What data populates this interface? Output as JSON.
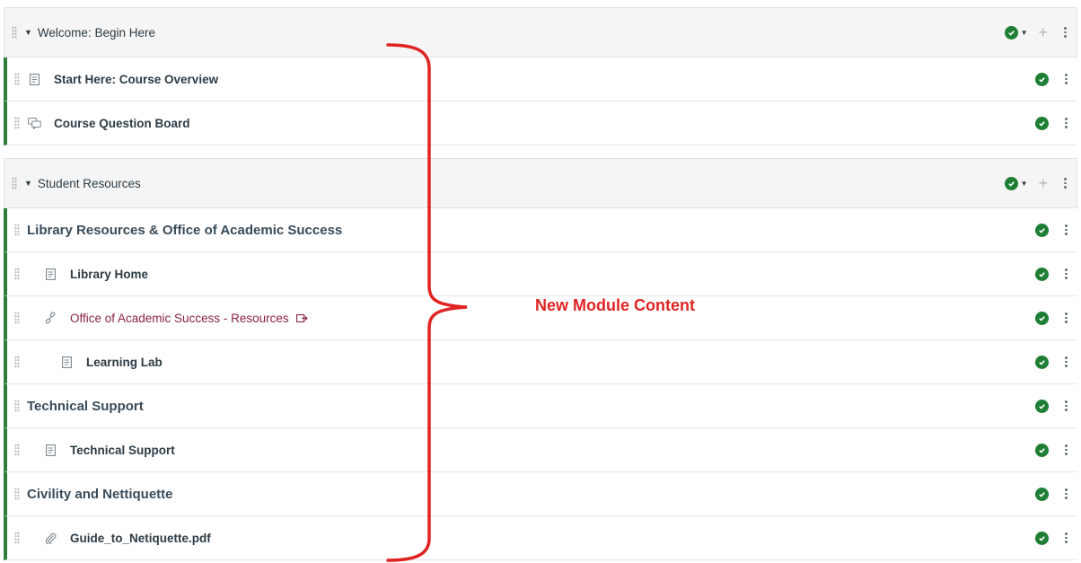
{
  "modules": [
    {
      "title": "Welcome: Begin Here",
      "items": [
        {
          "title": "Start Here: Course Overview",
          "icon": "page-icon"
        },
        {
          "title": "Course Question Board",
          "icon": "discussion-icon"
        }
      ]
    },
    {
      "title": "Student Resources",
      "items": [
        {
          "title": "Library Resources & Office of Academic Success",
          "kind": "subheader"
        },
        {
          "title": "Library Home",
          "icon": "page-icon"
        },
        {
          "title": "Office of Academic Success - Resources",
          "icon": "link-icon",
          "external": true
        },
        {
          "title": "Learning Lab",
          "icon": "page-icon"
        },
        {
          "title": "Technical Support",
          "kind": "subheader"
        },
        {
          "title": "Technical Support",
          "icon": "page-icon"
        },
        {
          "title": "Civility and Nettiquette",
          "kind": "subheader"
        },
        {
          "title": "Guide_to_Netiquette.pdf",
          "icon": "attachment-icon"
        }
      ]
    }
  ],
  "annotation": {
    "label": "New Module Content",
    "color": "#e02323"
  },
  "colors": {
    "published": "#1e7e34",
    "external_link": "#8a2245",
    "module_border": "#2e7d3b"
  }
}
